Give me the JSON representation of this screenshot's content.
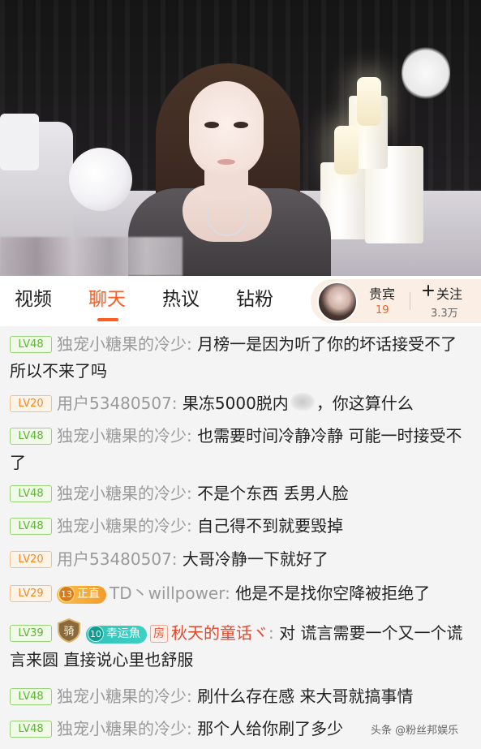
{
  "tabs": [
    {
      "label": "视频",
      "active": false
    },
    {
      "label": "聊天",
      "active": true
    },
    {
      "label": "热议",
      "active": false
    },
    {
      "label": "钻粉",
      "active": false
    }
  ],
  "vip": {
    "label": "贵宾",
    "count": "19"
  },
  "follow": {
    "label": "关注",
    "count": "3.3万"
  },
  "accent_color": "#ff5a1f",
  "chat": [
    {
      "level": "LV48",
      "level_color": "green",
      "user": "独宠小糖果的冷少",
      "sep": ":",
      "text": "月榜一是因为听了你的坏话接受不了 所以不来了吗"
    },
    {
      "level": "LV20",
      "level_color": "orange",
      "user": "用户53480507",
      "sep": ":",
      "text_before": "果冻5000脱内",
      "text_after": "，你这算什么"
    },
    {
      "level": "LV48",
      "level_color": "green",
      "user": "独宠小糖果的冷少",
      "sep": ":",
      "text": "也需要时间冷静冷静 可能一时接受不了"
    },
    {
      "level": "LV48",
      "level_color": "green",
      "user": "独宠小糖果的冷少",
      "sep": ":",
      "text": "不是个东西 丢男人脸"
    },
    {
      "level": "LV48",
      "level_color": "green",
      "user": "独宠小糖果的冷少",
      "sep": ":",
      "text": "自己得不到就要毁掉"
    },
    {
      "level": "LV20",
      "level_color": "orange",
      "user": "用户53480507",
      "sep": ":",
      "text": "大哥冷静一下就好了"
    },
    {
      "level": "LV29",
      "level_color": "orange",
      "badge_num": "13",
      "badge_text": "正直",
      "user": "TD丶willpower",
      "sep": ":",
      "text": "他是不是找你空降被拒绝了"
    },
    {
      "level": "LV39",
      "level_color": "green",
      "knight_icon": "骑",
      "badge_num": "10",
      "badge_text": "幸运魚",
      "fang": "房",
      "user": "秋天的童话ヾ",
      "sep": ":",
      "text": "对 谎言需要一个又一个谎言来圆 直接说心里也舒服"
    },
    {
      "level": "LV48",
      "level_color": "green",
      "user": "独宠小糖果的冷少",
      "sep": ":",
      "text": "刷什么存在感 来大哥就搞事情"
    },
    {
      "level": "LV48",
      "level_color": "green",
      "user": "独宠小糖果的冷少",
      "sep": ":",
      "text": "那个人给你刷了多少"
    }
  ],
  "watermark": "头条 @粉丝邦娱乐"
}
